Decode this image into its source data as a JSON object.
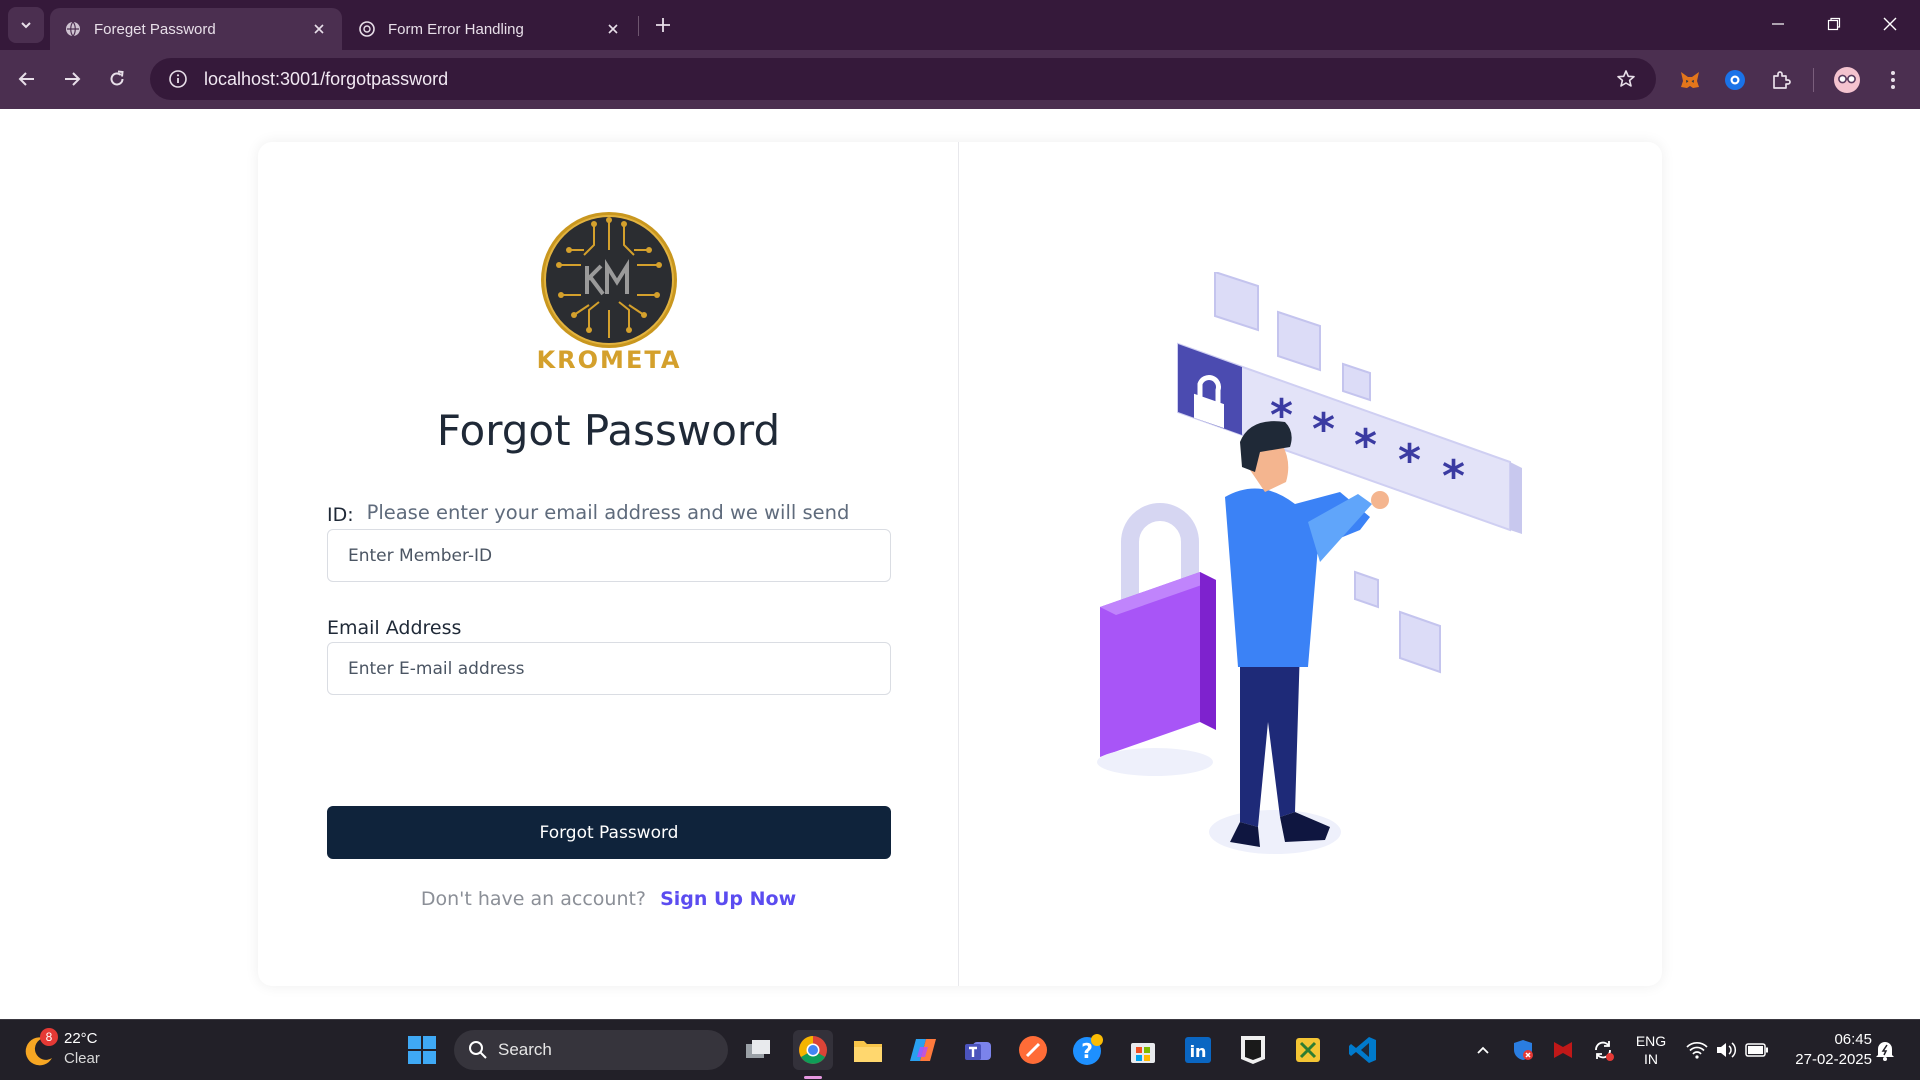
{
  "browser": {
    "tabs": [
      {
        "title": "Foreget Password",
        "active": true
      },
      {
        "title": "Form Error Handling",
        "active": false
      }
    ],
    "url": "localhost:3001/forgotpassword"
  },
  "form": {
    "brand": "KROMETA",
    "title": "Forgot Password",
    "description": "Please enter your email address and we will send you a password password link.",
    "id_label": "ID:",
    "id_placeholder": "Enter Member-ID",
    "email_label": "Email Address",
    "email_placeholder": "Enter E-mail address",
    "submit_label": "Forgot Password",
    "signup_question": "Don't have an account?",
    "signup_link": "Sign Up Now"
  },
  "taskbar": {
    "weather_temp": "22°C",
    "weather_condition": "Clear",
    "weather_badge": "8",
    "search_label": "Search",
    "language_line1": "ENG",
    "language_line2": "IN",
    "time": "06:45",
    "date": "27-02-2025"
  },
  "colors": {
    "chrome_dark": "#35193a",
    "chrome_mid": "#4b2f50",
    "button_navy": "#0f233b",
    "link_purple": "#5b4cf0",
    "brand_gold": "#d4a02c"
  }
}
